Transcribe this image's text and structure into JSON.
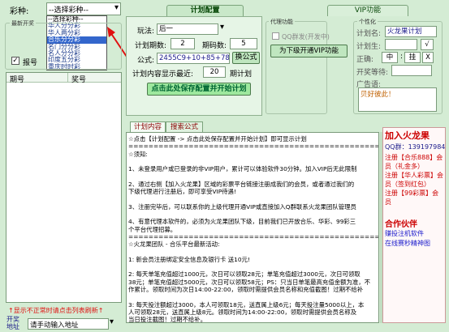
{
  "lottery": {
    "label": "彩种:",
    "selected": "--选择彩种--",
    "options": [
      "--选择彩种--",
      "华人分分彩",
      "华人两分彩",
      "合乐分分彩",
      "名门分分彩",
      "名人分分彩",
      "印度五分彩",
      "重庆时时彩"
    ],
    "highlighted_index": 3
  },
  "lottery_group": {
    "title": "最新开奖"
  },
  "record": {
    "label": "报号",
    "checked": true
  },
  "results_table": {
    "col_issue": "期号",
    "col_code": "奖号"
  },
  "left_footer": {
    "warning": "↑显示不正常时请点击列表刷新↑",
    "switch_label": "开奖\n地址",
    "address_placeholder": "请手动输入地址"
  },
  "tabs": {
    "plan": "计划配置",
    "vip": "VIP功能"
  },
  "plan": {
    "play_label": "玩法:",
    "play_value": "后一",
    "periods_label": "计划期数:",
    "periods_value": "2",
    "codes_label": "期码数:",
    "codes_value": "5",
    "formula_label": "公式:",
    "formula_value": "2455C9+10+85+78+8",
    "formula_button": "换公式",
    "plan_count_label": "计划内容显示最近:",
    "plan_count_value": "20",
    "plan_count_unit": "期计划",
    "save_button": "点击此处保存配置并开始计划"
  },
  "proxy": {
    "title": "代理功能",
    "qq_label": "QQ群发(开发中)",
    "vip_button": "为下级开通VIP功能"
  },
  "personal": {
    "title": "个性化",
    "plan_name_label": "计划名:",
    "plan_name_value": "火龙果计划",
    "plan_gen_label": "计划生:",
    "plan_gen_value": "",
    "gen_checkbox": "√",
    "bracket_label": "正确:",
    "bracket_open": "中",
    "bracket_close": "挂",
    "bracket_x": "X",
    "wait_label": "开奖等待:",
    "wait_value": "",
    "ad_label": "广告语:",
    "ad_value": "贝好彼此！"
  },
  "content_tabs": {
    "content": "计划内容",
    "search": "搜索公式"
  },
  "content_lines": [
    "☆点击【计划配置 -> 点击此处保存配置并开始计划】即可显示计划",
    "====================================================================",
    "☆须知:",
    "",
    "1、未登录用户或已登录的非VIP用户，累计可以体验软件30分钟。加入VIP后无此限制",
    "",
    "2、通过右侧【加入火龙果】区域的彩票平台链接注册成我们的会员，或者通过我们的",
    "下级代理进行注册后，即可享受VIP待遇!",
    "",
    "3、注册完毕后，可以联系你的上级代理开通VIP或直接加入Q群联系火龙果团队管理员",
    "",
    "4、有意代理本软件的，必须为火龙果团队下级，目前我们已开放合乐、华彩、99彩三",
    "个平台代理招募。",
    "====================================================================",
    "☆火龙果团队 - 合乐平台最新活动:",
    "",
    "1: 新会员注册绑定安全信息及银行卡    送10元!",
    "",
    "2: 每天单笔充值超过1000元，次日可以领取28元；单笔充值超过3000元，次日可领取",
    "38元；单笔充值超过5000元，次日可以领取58元；PS：只当日单笔最高充值金额为准，不",
    "作累计。领取时间为次日14:00-22:00，领取时需提供会员名称和充值截图！过期不给补",
    "",
    "3: 每天投注额超过3000，本人可领取18元，送直属上级6元；每天投注量5000以上，本",
    "人可领取28元，送直属上级8元。领取时间为14:00-22:00，领取时需提供会员名称及",
    "当日投注截图！过期不给补。"
  ],
  "join": {
    "title": "加入火龙果",
    "qq_group": "QQ群：139197984",
    "links": [
      "注册【合乐888】会员（礼金多）",
      "注册【华人彩票】会员（签到红包）",
      "注册【99彩票】会员"
    ],
    "partner_title": "合作伙伴",
    "partner_links": [
      "赚投注机软件",
      "在线赛秒精神图"
    ]
  },
  "colors": {
    "bg": "#d4ecd4",
    "panel": "#e6f5e6",
    "save_btn": "#9ee89e",
    "highlight": "#3366cc",
    "link_red": "#cc0000",
    "link_blue": "#1a1acc"
  }
}
